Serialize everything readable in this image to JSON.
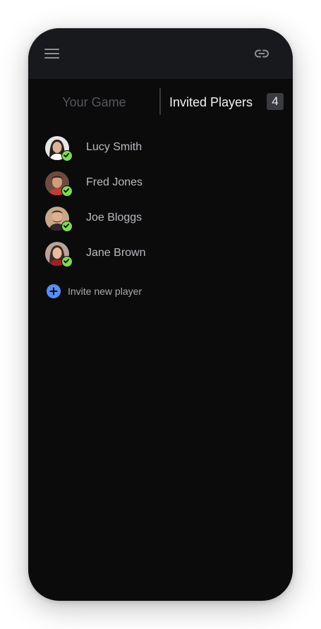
{
  "header": {
    "menu_icon": "hamburger-menu-icon",
    "link_icon": "link-icon"
  },
  "tabs": {
    "your_game": "Your Game",
    "invited_players": "Invited Players",
    "invited_count": "4"
  },
  "players": [
    {
      "name": "Lucy Smith",
      "status": "accepted"
    },
    {
      "name": "Fred Jones",
      "status": "accepted"
    },
    {
      "name": "Joe Bloggs",
      "status": "accepted"
    },
    {
      "name": "Jane Brown",
      "status": "accepted"
    }
  ],
  "invite": {
    "label": "Invite new player",
    "icon": "plus-circle-icon"
  },
  "colors": {
    "background": "#0b0b0c",
    "topbar": "#18191c",
    "accent_blue": "#5a8df2",
    "accepted_green": "#7ed957"
  }
}
